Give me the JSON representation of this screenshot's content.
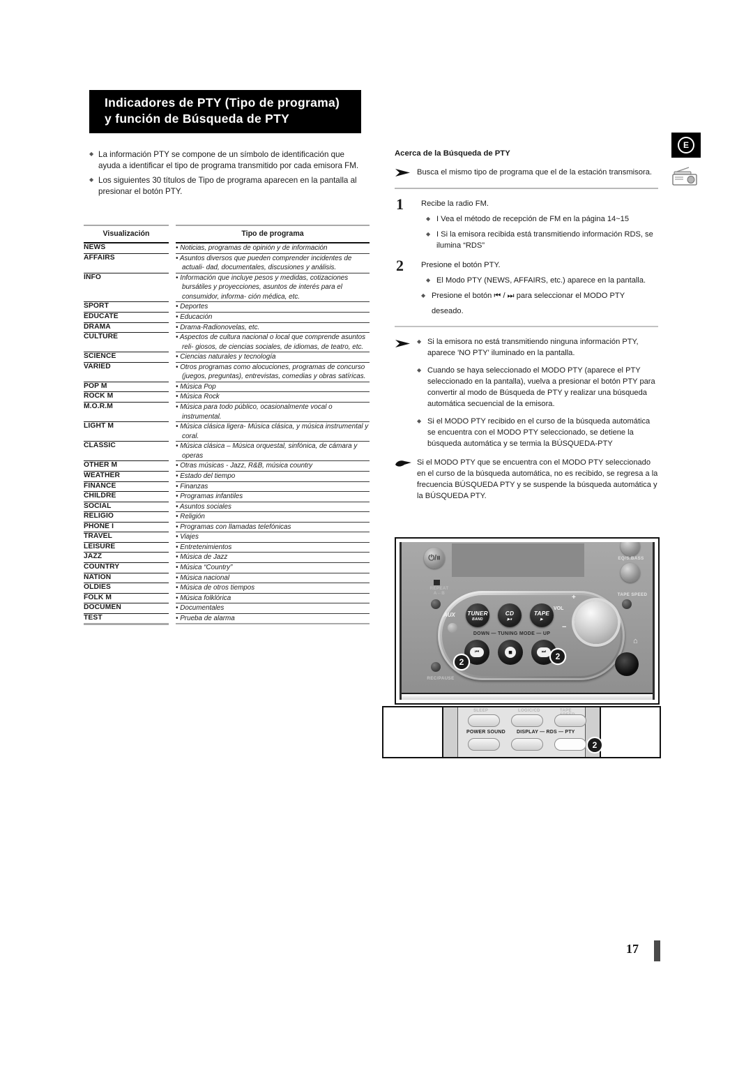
{
  "header": {
    "title_line1": "Indicadores de PTY (Tipo de programa)",
    "title_line2": "y función de Búsqueda de PTY"
  },
  "corner": {
    "region_letter": "E",
    "radio_icon": "radio-icon"
  },
  "left": {
    "intro": [
      "La información PTY se compone de un símbolo de identificación que ayuda a identificar el tipo de programa transmitido por cada emisora FM.",
      "Los siguientes 30 títulos de Tipo de programa aparecen en la pantalla al presionar el botón PTY."
    ],
    "table": {
      "headers": [
        "Visualización",
        "Tipo de programa"
      ],
      "rows": [
        {
          "display": "NEWS",
          "desc": "• Noticias, programas de opinión y de información"
        },
        {
          "display": "AFFAIRS",
          "desc": "• Asuntos diversos que pueden comprender incidentes de actuali- dad, documentales, discusiones y análisis."
        },
        {
          "display": "INFO",
          "desc": "• Información que incluye pesos y medidas, cotizaciones bursátiles y proyecciones, asuntos de interés para el consumidor, informa- ción médica, etc."
        },
        {
          "display": "SPORT",
          "desc": "• Deportes"
        },
        {
          "display": "EDUCATE",
          "desc": "• Educación"
        },
        {
          "display": "DRAMA",
          "desc": "• Drama-Radionovelas, etc."
        },
        {
          "display": "CULTURE",
          "desc": "• Aspectos de cultura nacional o local que comprende asuntos reli- giosos, de ciencias sociales, de idiomas, de teatro, etc."
        },
        {
          "display": "SCIENCE",
          "desc": "• Ciencias naturales y tecnología"
        },
        {
          "display": "VARIED",
          "desc": "• Otros programas como alocuciones, programas de concurso (juegos, preguntas), entrevistas, comedias y obras satíricas."
        },
        {
          "display": "POP M",
          "desc": "• Música Pop"
        },
        {
          "display": "ROCK M",
          "desc": "• Música Rock"
        },
        {
          "display": "M.O.R.M",
          "desc": "• Música para todo público, ocasionalmente vocal o instrumental."
        },
        {
          "display": "LIGHT M",
          "desc": "• Música clásica ligera- Música clásica, y música instrumental y coral."
        },
        {
          "display": "CLASSIC",
          "desc": "• Música clásica – Música orquestal, sinfónica, de cámara y operas"
        },
        {
          "display": "OTHER M",
          "desc": "• Otras músicas - Jazz, R&B, música country"
        },
        {
          "display": "WEATHER",
          "desc": "• Estado del tiempo"
        },
        {
          "display": "FINANCE",
          "desc": "• Finanzas"
        },
        {
          "display": "CHILDRE",
          "desc": "• Programas infantiles"
        },
        {
          "display": "SOCIAL",
          "desc": "• Asuntos sociales"
        },
        {
          "display": "RELIGIO",
          "desc": "• Religión"
        },
        {
          "display": "PHONE I",
          "desc": "• Programas con llamadas telefónicas"
        },
        {
          "display": "TRAVEL",
          "desc": "• Viajes"
        },
        {
          "display": "LEISURE",
          "desc": "• Entretenimientos"
        },
        {
          "display": "JAZZ",
          "desc": "• Música de Jazz"
        },
        {
          "display": "COUNTRY",
          "desc": "• Música “Country”"
        },
        {
          "display": "NATION",
          "desc": "• Música nacional"
        },
        {
          "display": "OLDIES",
          "desc": "• Música de otros tiempos"
        },
        {
          "display": "FOLK M",
          "desc": "• Música folklórica"
        },
        {
          "display": "DOCUMEN",
          "desc": "• Documentales"
        },
        {
          "display": "TEST",
          "desc": "• Prueba de alarma"
        }
      ]
    }
  },
  "right": {
    "section_title": "Acerca de la Búsqueda de PTY",
    "lead_note": "Busca el mismo tipo de programa que el de la estación transmisora.",
    "step1": {
      "number": "1",
      "head": "Recibe la radio FM.",
      "bullets": [
        "I Vea el método de recepción de FM en la página 14~15",
        "I Si la emisora recibida está transmitiendo información RDS, se ilumina “RDS”"
      ]
    },
    "step2": {
      "number": "2",
      "head": "Presione el botón PTY.",
      "bullets": [
        "El Modo PTY (NEWS, AFFAIRS, etc.) aparece en la pantalla.",
        "Presione el botón ⏮ / ⏭ para seleccionar el MODO PTY",
        "deseado."
      ]
    },
    "notes": [
      "Si la emisora no está transmitiendo ninguna información PTY, aparece 'NO PTY' iluminado en la pantalla.",
      "Cuando se haya seleccionado el MODO PTY (aparece el PTY seleccionado en la pantalla), vuelva a presionar el botón PTY para convertir al modo de Búsqueda de PTY y realizar una búsqueda automática secuencial de la emisora.",
      "Si el MODO PTY recibido en el curso de la búsqueda automática se encuentra con el MODO PTY seleccionado, se detiene la búsqueda automática y se termia la BÚSQUEDA-PTY"
    ],
    "hand_note": "Si el MODO PTY que se encuentra con el MODO PTY seleccionado en el curso de la búsqueda automática, no es recibido, se regresa a la frecuencia BÚSQUEDA PTY y se suspende la búsqueda automática y la BÚSQUEDA PTY."
  },
  "device": {
    "power_glyph": "⏻/⏸",
    "labels": {
      "eq_sbass": "EQ/S.BASS",
      "tape_speed": "TAPE SPEED",
      "repeat": "REPEAT",
      "repeat_ab": "A↔B",
      "rec_pause": "REC/PAUSE",
      "aux": "AUX",
      "tuning_mode": "DOWN — TUNING MODE — UP",
      "vol": "VOL",
      "plus": "+",
      "minus": "−",
      "headphones": "⌂"
    },
    "buttons": [
      {
        "main": "TUNER",
        "sub": "BAND"
      },
      {
        "main": "CD",
        "sub": "▶⏸"
      },
      {
        "main": "TAPE",
        "sub": "▶"
      }
    ],
    "nav": {
      "prev": "⏮",
      "stop": "◼",
      "next": "⏭"
    },
    "callouts": [
      "2",
      "2"
    ]
  },
  "remote": {
    "faint_labels": [
      "SLEEP",
      "LOGIC/CD",
      "TAPE SPEED"
    ],
    "labels": [
      "POWER SOUND",
      "DISPLAY — RDS — PTY"
    ],
    "callout": "2"
  },
  "footer": {
    "page_number": "17"
  }
}
